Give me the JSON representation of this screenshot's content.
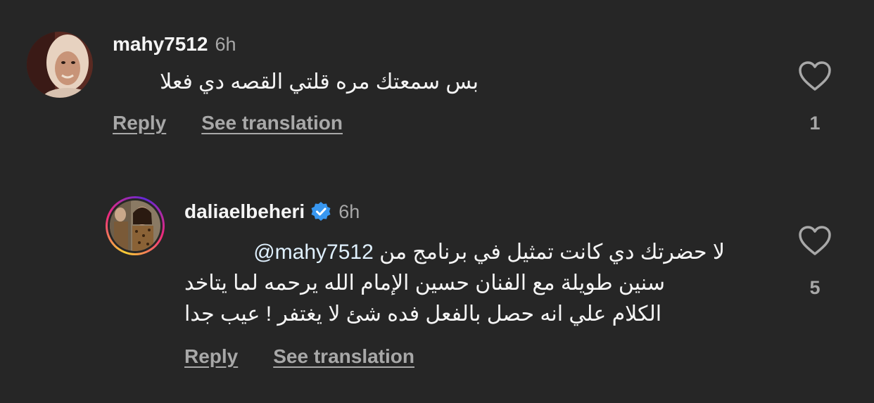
{
  "comments": [
    {
      "username": "mahy7512",
      "time": "6h",
      "text": "بس سمعتك مره قلتي القصه دي فعلا",
      "reply_label": "Reply",
      "translate_label": "See translation",
      "likes": "1",
      "verified": false,
      "avatar_icon": "profile-photo"
    },
    {
      "username": "daliaelbeheri",
      "time": "6h",
      "mention": "@mahy7512",
      "lines": [
        "لا حضرتك دي كانت تمثيل في برنامج من",
        "سنين طويلة مع الفنان حسين الإمام الله يرحمه لما يتاخد",
        "الكلام علي انه حصل بالفعل فده شئ لا يغتفر ! عيب جدا"
      ],
      "reply_label": "Reply",
      "translate_label": "See translation",
      "likes": "5",
      "verified": true,
      "verified_icon": "verified-badge-icon",
      "avatar_icon": "profile-photo-story-ring"
    }
  ],
  "colors": {
    "background": "#262626",
    "primary_text": "#f5f5f5",
    "secondary_text": "#a8a8a8",
    "verified_blue": "#3897f0"
  }
}
